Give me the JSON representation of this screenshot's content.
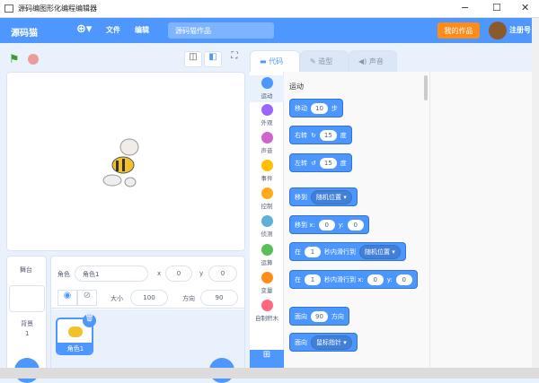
{
  "window": {
    "title": "源码编图形化编程编辑器",
    "minimize": "−",
    "maximize": "☐",
    "close": "✕"
  },
  "menubar": {
    "logo": "源码猫",
    "globe_icon": "globe-icon",
    "file": "文件",
    "edit": "编辑",
    "project_title": "源码猫作品",
    "my_works": "我的作品",
    "register": "注册号",
    "accent": "#4d97ff"
  },
  "tabs": [
    {
      "label": "代码",
      "active": true
    },
    {
      "label": "造型"
    },
    {
      "label": "声音"
    }
  ],
  "categories": [
    {
      "label": "运动",
      "color": "#4c97ff"
    },
    {
      "label": "外观",
      "color": "#9966ff"
    },
    {
      "label": "声音",
      "color": "#cf63cf"
    },
    {
      "label": "事件",
      "color": "#ffbf00"
    },
    {
      "label": "控制",
      "color": "#ffab19"
    },
    {
      "label": "侦测",
      "color": "#5cb1d6"
    },
    {
      "label": "运算",
      "color": "#59c059"
    },
    {
      "label": "变量",
      "color": "#ff8c1a"
    },
    {
      "label": "自制积木",
      "color": "#ff6680"
    }
  ],
  "palette": {
    "heading": "运动",
    "blocks": {
      "move": {
        "a": "移动",
        "v": "10",
        "b": "步"
      },
      "turn_right": {
        "a": "右转",
        "v": "15",
        "b": "度"
      },
      "turn_left": {
        "a": "左转",
        "v": "15",
        "b": "度"
      },
      "goto": {
        "a": "移到",
        "d": "随机位置"
      },
      "goto_xy": {
        "a": "移到 x:",
        "x": "0",
        "y_label": "y:",
        "y": "0"
      },
      "glide": {
        "a": "在",
        "v": "1",
        "b": "秒内滑行到",
        "d": "随机位置"
      },
      "glide_xy": {
        "a": "在",
        "v": "1",
        "b": "秒内滑行到 x:",
        "x": "0",
        "y_label": "y:",
        "y": "0"
      },
      "point_dir": {
        "a": "面向",
        "v": "90",
        "b": "方向"
      },
      "point_towards": {
        "a": "面向",
        "d": "鼠标指针"
      }
    }
  },
  "sprite_info": {
    "sprite_label": "角色",
    "sprite_name": "角色1",
    "x_label": "x",
    "x": "0",
    "y_label": "y",
    "y": "0",
    "size_label": "大小",
    "size": "100",
    "direction_label": "方向",
    "direction": "90"
  },
  "sprites": [
    {
      "name": "角色1"
    }
  ],
  "stage_panel": {
    "title": "舞台",
    "backdrop_label": "背景",
    "backdrop_count": "1"
  }
}
